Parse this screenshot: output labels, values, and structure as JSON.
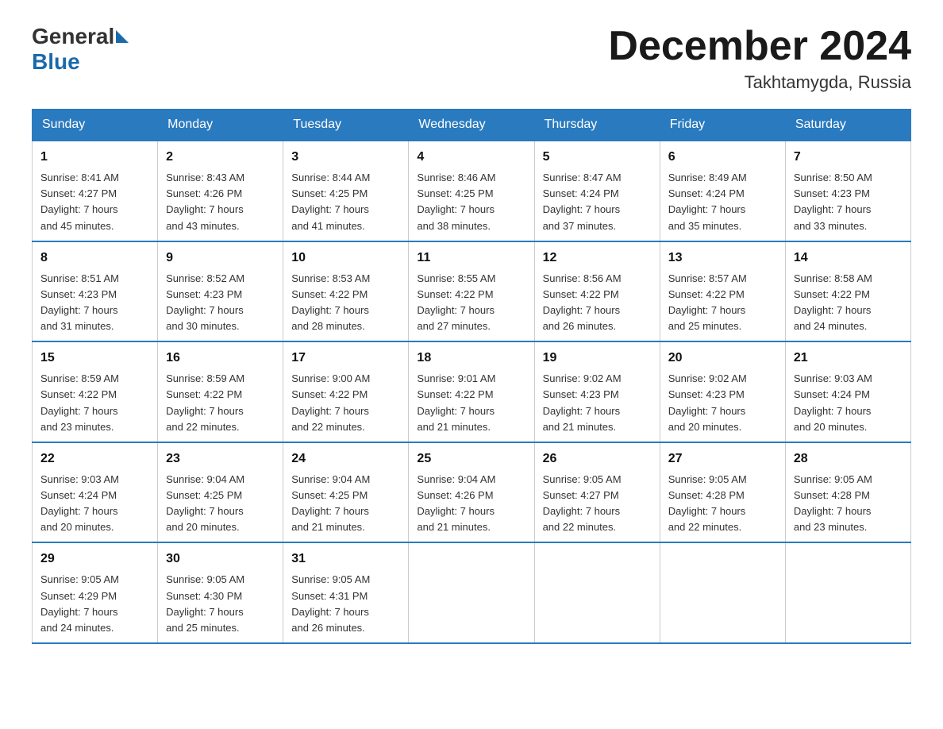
{
  "header": {
    "logo_general": "General",
    "logo_blue": "Blue",
    "month_title": "December 2024",
    "location": "Takhtamygda, Russia"
  },
  "weekdays": [
    "Sunday",
    "Monday",
    "Tuesday",
    "Wednesday",
    "Thursday",
    "Friday",
    "Saturday"
  ],
  "weeks": [
    [
      {
        "day": "1",
        "info": "Sunrise: 8:41 AM\nSunset: 4:27 PM\nDaylight: 7 hours\nand 45 minutes."
      },
      {
        "day": "2",
        "info": "Sunrise: 8:43 AM\nSunset: 4:26 PM\nDaylight: 7 hours\nand 43 minutes."
      },
      {
        "day": "3",
        "info": "Sunrise: 8:44 AM\nSunset: 4:25 PM\nDaylight: 7 hours\nand 41 minutes."
      },
      {
        "day": "4",
        "info": "Sunrise: 8:46 AM\nSunset: 4:25 PM\nDaylight: 7 hours\nand 38 minutes."
      },
      {
        "day": "5",
        "info": "Sunrise: 8:47 AM\nSunset: 4:24 PM\nDaylight: 7 hours\nand 37 minutes."
      },
      {
        "day": "6",
        "info": "Sunrise: 8:49 AM\nSunset: 4:24 PM\nDaylight: 7 hours\nand 35 minutes."
      },
      {
        "day": "7",
        "info": "Sunrise: 8:50 AM\nSunset: 4:23 PM\nDaylight: 7 hours\nand 33 minutes."
      }
    ],
    [
      {
        "day": "8",
        "info": "Sunrise: 8:51 AM\nSunset: 4:23 PM\nDaylight: 7 hours\nand 31 minutes."
      },
      {
        "day": "9",
        "info": "Sunrise: 8:52 AM\nSunset: 4:23 PM\nDaylight: 7 hours\nand 30 minutes."
      },
      {
        "day": "10",
        "info": "Sunrise: 8:53 AM\nSunset: 4:22 PM\nDaylight: 7 hours\nand 28 minutes."
      },
      {
        "day": "11",
        "info": "Sunrise: 8:55 AM\nSunset: 4:22 PM\nDaylight: 7 hours\nand 27 minutes."
      },
      {
        "day": "12",
        "info": "Sunrise: 8:56 AM\nSunset: 4:22 PM\nDaylight: 7 hours\nand 26 minutes."
      },
      {
        "day": "13",
        "info": "Sunrise: 8:57 AM\nSunset: 4:22 PM\nDaylight: 7 hours\nand 25 minutes."
      },
      {
        "day": "14",
        "info": "Sunrise: 8:58 AM\nSunset: 4:22 PM\nDaylight: 7 hours\nand 24 minutes."
      }
    ],
    [
      {
        "day": "15",
        "info": "Sunrise: 8:59 AM\nSunset: 4:22 PM\nDaylight: 7 hours\nand 23 minutes."
      },
      {
        "day": "16",
        "info": "Sunrise: 8:59 AM\nSunset: 4:22 PM\nDaylight: 7 hours\nand 22 minutes."
      },
      {
        "day": "17",
        "info": "Sunrise: 9:00 AM\nSunset: 4:22 PM\nDaylight: 7 hours\nand 22 minutes."
      },
      {
        "day": "18",
        "info": "Sunrise: 9:01 AM\nSunset: 4:22 PM\nDaylight: 7 hours\nand 21 minutes."
      },
      {
        "day": "19",
        "info": "Sunrise: 9:02 AM\nSunset: 4:23 PM\nDaylight: 7 hours\nand 21 minutes."
      },
      {
        "day": "20",
        "info": "Sunrise: 9:02 AM\nSunset: 4:23 PM\nDaylight: 7 hours\nand 20 minutes."
      },
      {
        "day": "21",
        "info": "Sunrise: 9:03 AM\nSunset: 4:24 PM\nDaylight: 7 hours\nand 20 minutes."
      }
    ],
    [
      {
        "day": "22",
        "info": "Sunrise: 9:03 AM\nSunset: 4:24 PM\nDaylight: 7 hours\nand 20 minutes."
      },
      {
        "day": "23",
        "info": "Sunrise: 9:04 AM\nSunset: 4:25 PM\nDaylight: 7 hours\nand 20 minutes."
      },
      {
        "day": "24",
        "info": "Sunrise: 9:04 AM\nSunset: 4:25 PM\nDaylight: 7 hours\nand 21 minutes."
      },
      {
        "day": "25",
        "info": "Sunrise: 9:04 AM\nSunset: 4:26 PM\nDaylight: 7 hours\nand 21 minutes."
      },
      {
        "day": "26",
        "info": "Sunrise: 9:05 AM\nSunset: 4:27 PM\nDaylight: 7 hours\nand 22 minutes."
      },
      {
        "day": "27",
        "info": "Sunrise: 9:05 AM\nSunset: 4:28 PM\nDaylight: 7 hours\nand 22 minutes."
      },
      {
        "day": "28",
        "info": "Sunrise: 9:05 AM\nSunset: 4:28 PM\nDaylight: 7 hours\nand 23 minutes."
      }
    ],
    [
      {
        "day": "29",
        "info": "Sunrise: 9:05 AM\nSunset: 4:29 PM\nDaylight: 7 hours\nand 24 minutes."
      },
      {
        "day": "30",
        "info": "Sunrise: 9:05 AM\nSunset: 4:30 PM\nDaylight: 7 hours\nand 25 minutes."
      },
      {
        "day": "31",
        "info": "Sunrise: 9:05 AM\nSunset: 4:31 PM\nDaylight: 7 hours\nand 26 minutes."
      },
      {
        "day": "",
        "info": ""
      },
      {
        "day": "",
        "info": ""
      },
      {
        "day": "",
        "info": ""
      },
      {
        "day": "",
        "info": ""
      }
    ]
  ]
}
